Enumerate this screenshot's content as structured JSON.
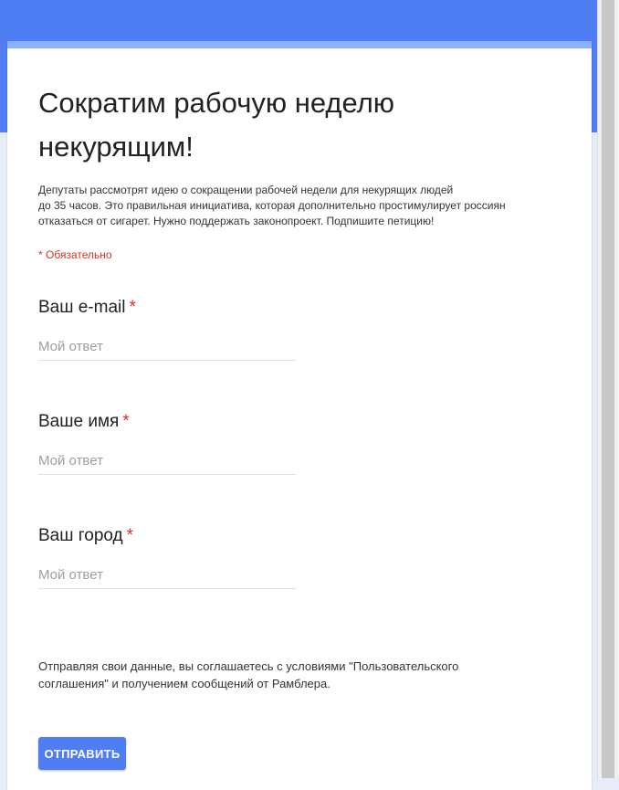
{
  "form": {
    "title": "Сократим рабочую неделю некурящим!",
    "description": "Депутаты рассмотрят идею о сокращении рабочей недели для некурящих людей до 35 часов. Это правильная инициатива, которая дополнительно простимулирует россиян отказаться от сигарет. Нужно поддержать законопроект. Подпишите петицию!",
    "description_lines": [
      "Депутаты рассмотрят идею о сокращении рабочей недели для некурящих людей",
      "до 35 часов. Это правильная инициатива, которая дополнительно простимулирует россиян",
      "отказаться от сигарет. Нужно поддержать законопроект. Подпишите петицию!"
    ],
    "required_note": "* Обязательно",
    "questions": [
      {
        "label": "Ваш e-mail",
        "required_mark": "*",
        "placeholder": "Мой ответ",
        "value": ""
      },
      {
        "label": "Ваше имя",
        "required_mark": "*",
        "placeholder": "Мой ответ",
        "value": ""
      },
      {
        "label": "Ваш город",
        "required_mark": "*",
        "placeholder": "Мой ответ",
        "value": ""
      }
    ],
    "consent_lines": [
      "Отправляя свои данные, вы соглашаетесь с условиями \"Пользовательского",
      "соглашения\" и получением  сообщений от Рамблера."
    ],
    "submit_label": "ОТПРАВИТЬ"
  },
  "colors": {
    "accent": "#4f7df3",
    "accent_light": "#8fb0fa",
    "required": "#d93025",
    "background": "#e8ecf8"
  }
}
